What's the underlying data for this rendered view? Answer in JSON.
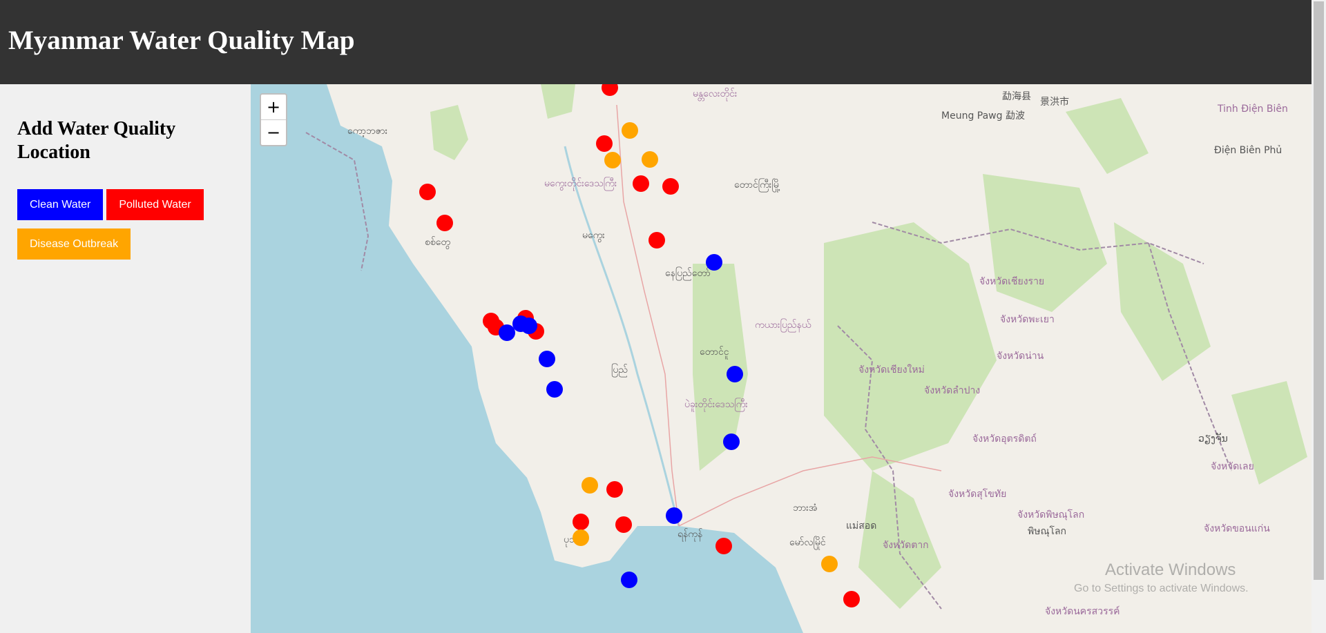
{
  "header": {
    "title": "Myanmar Water Quality Map"
  },
  "sidebar": {
    "title": "Add Water Quality Location",
    "buttons": [
      {
        "id": "clean",
        "label": "Clean Water",
        "color": "#0000ff"
      },
      {
        "id": "polluted",
        "label": "Polluted Water",
        "color": "#ff0000"
      },
      {
        "id": "disease",
        "label": "Disease Outbreak",
        "color": "#ffa500"
      }
    ]
  },
  "map": {
    "zoom_in": "+",
    "zoom_out": "−",
    "colors": {
      "clean": "#0000ff",
      "polluted": "#ff0000",
      "disease": "#ffa500",
      "sea": "#aad3df",
      "land": "#f2efe9",
      "forest": "#cde4b6"
    },
    "places": [
      {
        "text": "ကော့ဘဇား",
        "type": "place"
      },
      {
        "text": "စစ်တွေ",
        "type": "place"
      },
      {
        "text": "မကွေး",
        "type": "place"
      },
      {
        "text": "နေပြည်တော်",
        "type": "place"
      },
      {
        "text": "မန္တလေးတိုင်း",
        "type": "region"
      },
      {
        "text": "မကွေးတိုင်းဒေသကြီး",
        "type": "region"
      },
      {
        "text": "ကယားပြည်နယ်",
        "type": "region"
      },
      {
        "text": "ပဲခူးတိုင်းဒေသကြီး",
        "type": "region"
      },
      {
        "text": "ရန်ကုန်",
        "type": "place"
      },
      {
        "text": "ပုသိမ်",
        "type": "place"
      },
      {
        "text": "ပြည်",
        "type": "place"
      },
      {
        "text": "တောင်ငူ",
        "type": "place"
      },
      {
        "text": "ဘားအံ",
        "type": "place"
      },
      {
        "text": "မော်လမြိုင်",
        "type": "place"
      },
      {
        "text": "တောင်ကြီးမြို့",
        "type": "place"
      },
      {
        "text": "景洪市",
        "type": "place"
      },
      {
        "text": "勐海县",
        "type": "place"
      },
      {
        "text": "Meung Pawg 勐波",
        "type": "place"
      },
      {
        "text": "Tinh Điện Biên",
        "type": "place"
      },
      {
        "text": "Điện Biên Phủ",
        "type": "place"
      },
      {
        "text": "จังหวัดเชียงใหม่",
        "type": "place"
      },
      {
        "text": "จังหวัดน่าน",
        "type": "place"
      },
      {
        "text": "จังหวัดลำปาง",
        "type": "place"
      },
      {
        "text": "จังหวัดอุตรดิตถ์",
        "type": "place"
      },
      {
        "text": "จังหวัดสุโขทัย",
        "type": "place"
      },
      {
        "text": "จังหวัดพิษณุโลก",
        "type": "place"
      },
      {
        "text": "จังหวัดตาก",
        "type": "place"
      },
      {
        "text": "จังหวัดนครสวรรค์",
        "type": "place"
      },
      {
        "text": "จังหวัดเลย",
        "type": "place"
      },
      {
        "text": "จังหวัดขอนแก่น",
        "type": "place"
      },
      {
        "text": "พิษณุโลก",
        "type": "place"
      },
      {
        "text": "แม่สอด",
        "type": "place"
      },
      {
        "text": "จังหวัดพะเยา",
        "type": "place"
      },
      {
        "text": "จังหวัดเชียงราย",
        "type": "place"
      },
      {
        "text": "ວຽງຈັນ",
        "type": "place"
      }
    ],
    "markers_note": "markers plotted by status"
  },
  "watermark": {
    "line1": "Activate Windows",
    "line2": "Go to Settings to activate Windows."
  }
}
